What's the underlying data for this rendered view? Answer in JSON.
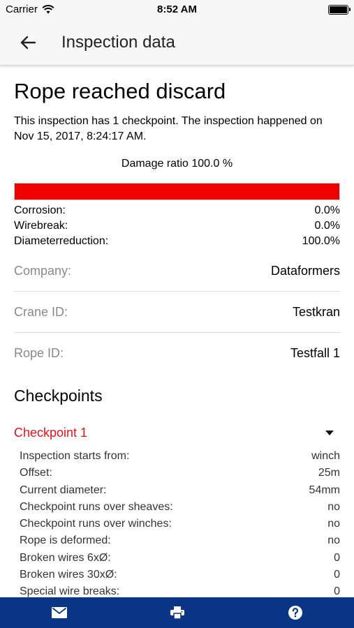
{
  "status_bar": {
    "carrier": "Carrier",
    "time": "8:52 AM"
  },
  "nav": {
    "title": "Inspection data",
    "back_icon": "arrow-left-icon"
  },
  "summary": {
    "heading": "Rope reached discard",
    "intro": "This inspection has 1 checkpoint. The inspection happened on Nov 15, 2017, 8:24:17 AM.",
    "damage_ratio_label": "Damage ratio 100.0 %",
    "damage_ratio_fraction": 1.0,
    "damage_bar_color": "#ee0000",
    "metrics": [
      {
        "label": "Corrosion:",
        "value": "0.0%"
      },
      {
        "label": "Wirebreak:",
        "value": "0.0%"
      },
      {
        "label": "Diameterreduction:",
        "value": "100.0%"
      }
    ]
  },
  "info": [
    {
      "label": "Company:",
      "value": "Dataformers"
    },
    {
      "label": "Crane ID:",
      "value": "Testkran"
    },
    {
      "label": "Rope ID:",
      "value": "Testfall 1"
    }
  ],
  "checkpoints": {
    "title": "Checkpoints",
    "items": [
      {
        "name": "Checkpoint 1",
        "accent": "#e8141a",
        "rows": [
          {
            "label": "Inspection starts from:",
            "value": "winch"
          },
          {
            "label": "Offset:",
            "value": "25m"
          },
          {
            "label": "Current diameter:",
            "value": "54mm"
          },
          {
            "label": "Checkpoint runs over sheaves:",
            "value": "no"
          },
          {
            "label": "Checkpoint runs over winches:",
            "value": "no"
          },
          {
            "label": "Rope is deformed:",
            "value": "no"
          },
          {
            "label": "Broken wires 6xØ:",
            "value": "0"
          },
          {
            "label": "Broken wires 30xØ:",
            "value": "0"
          },
          {
            "label": "Special wire breaks:",
            "value": "0"
          }
        ]
      }
    ]
  },
  "toolbar": {
    "color": "#0a3584",
    "icons": [
      "mail-icon",
      "print-icon",
      "help-icon"
    ]
  }
}
